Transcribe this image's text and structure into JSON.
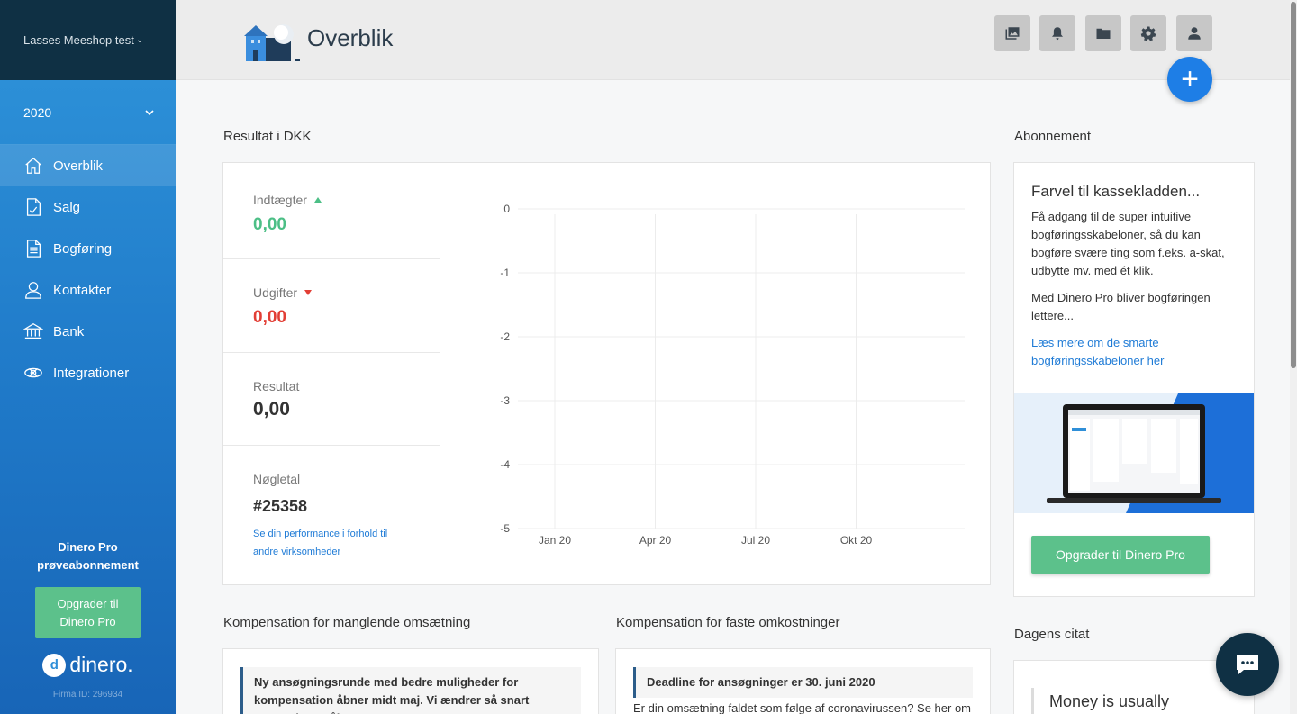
{
  "sidebar": {
    "company": "Lasses Meeshop test",
    "year": "2020",
    "items": [
      {
        "label": "Overblik",
        "icon": "home-icon"
      },
      {
        "label": "Salg",
        "icon": "invoice-icon"
      },
      {
        "label": "Bogføring",
        "icon": "ledger-icon"
      },
      {
        "label": "Kontakter",
        "icon": "person-icon"
      },
      {
        "label": "Bank",
        "icon": "bank-icon"
      },
      {
        "label": "Integrationer",
        "icon": "integration-icon"
      }
    ],
    "pro_line1": "Dinero Pro",
    "pro_line2": "prøveabonnement",
    "upgrade_line1": "Opgrader til",
    "upgrade_line2": "Dinero Pro",
    "logo_text": "dinero.",
    "firm_id": "Firma ID: 296934"
  },
  "header": {
    "title": "Overblik",
    "buttons": [
      "images-icon",
      "bell-icon",
      "folder-icon",
      "gear-icon",
      "user-icon"
    ],
    "fab_label": "+"
  },
  "result": {
    "title": "Resultat i DKK",
    "income_label": "Indtægter",
    "income_value": "0,00",
    "expense_label": "Udgifter",
    "expense_value": "0,00",
    "result_label": "Resultat",
    "result_value": "0,00",
    "key_label": "Nøgletal",
    "key_value": "#25358",
    "key_link": "Se din performance i forhold til andre virksomheder"
  },
  "chart_data": {
    "type": "line",
    "categories": [
      "Jan 20",
      "Apr 20",
      "Jul 20",
      "Okt 20"
    ],
    "series": [],
    "ylim": [
      -5,
      0
    ],
    "yticks": [
      "0",
      "-1",
      "-2",
      "-3",
      "-4",
      "-5"
    ],
    "grid": true
  },
  "subscription": {
    "title": "Abonnement",
    "headline": "Farvel til kassekladden...",
    "text1": "Få adgang til de super intuitive bogføringsskabeloner, så du kan bogføre svære ting som f.eks. a-skat, udbytte mv. med ét klik.",
    "text2": "Med Dinero Pro bliver bogføringen lettere...",
    "link": "Læs mere om de smarte bogføringsskabeloner her",
    "button": "Opgrader til Dinero Pro"
  },
  "comp_revenue": {
    "title": "Kompensation for manglende omsætning",
    "box": "Ny ansøgningsrunde med bedre muligheder for kompensation åbner midt maj. Vi ændrer så snart ansøgningen åbner"
  },
  "comp_costs": {
    "title": "Kompensation for faste omkostninger",
    "box": "Deadline for ansøgninger er 30. juni 2020",
    "text": "Er din omsætning faldet som følge af coronavirussen? Se her om"
  },
  "quote": {
    "title": "Dagens citat",
    "text": "Money is usually"
  },
  "colors": {
    "income": "#4cbf86",
    "expense": "#e23e35",
    "accent": "#1e7ee6",
    "green_button": "#5cc18b"
  }
}
